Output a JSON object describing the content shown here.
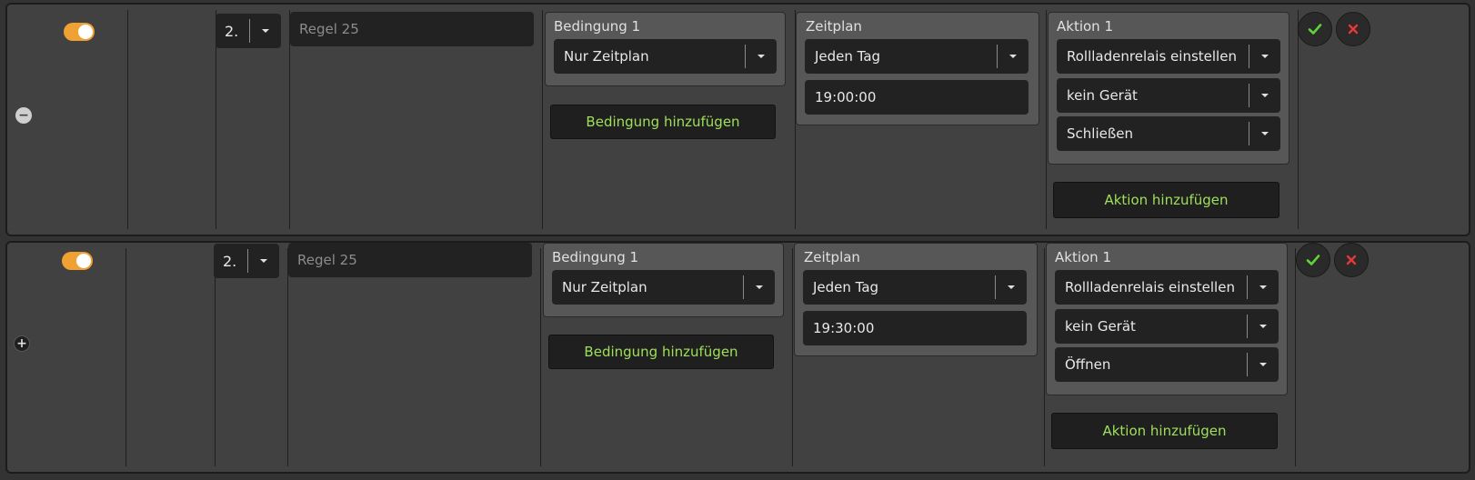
{
  "colors": {
    "toggle_on": "#f0a133",
    "add_text": "#9ee05a",
    "confirm": "#5fd33a",
    "cancel": "#e53935"
  },
  "rules": [
    {
      "enabled": true,
      "expand_icon": "minus-icon",
      "order": "2.",
      "name_placeholder": "Regel 25",
      "condition": {
        "title": "Bedingung 1",
        "value": "Nur Zeitplan"
      },
      "add_condition_label": "Bedingung hinzufügen",
      "schedule": {
        "title": "Zeitplan",
        "frequency": "Jeden Tag",
        "time": "19:00:00"
      },
      "action": {
        "title": "Aktion 1",
        "type": "Rollladenrelais einstellen",
        "device": "kein Gerät",
        "command": "Schließen"
      },
      "add_action_label": "Aktion hinzufügen"
    },
    {
      "enabled": true,
      "expand_icon": "plus-icon",
      "order": "2.",
      "name_placeholder": "Regel 25",
      "condition": {
        "title": "Bedingung 1",
        "value": "Nur Zeitplan"
      },
      "add_condition_label": "Bedingung hinzufügen",
      "schedule": {
        "title": "Zeitplan",
        "frequency": "Jeden Tag",
        "time": "19:30:00"
      },
      "action": {
        "title": "Aktion 1",
        "type": "Rollladenrelais einstellen",
        "device": "kein Gerät",
        "command": "Öffnen"
      },
      "add_action_label": "Aktion hinzufügen"
    }
  ]
}
